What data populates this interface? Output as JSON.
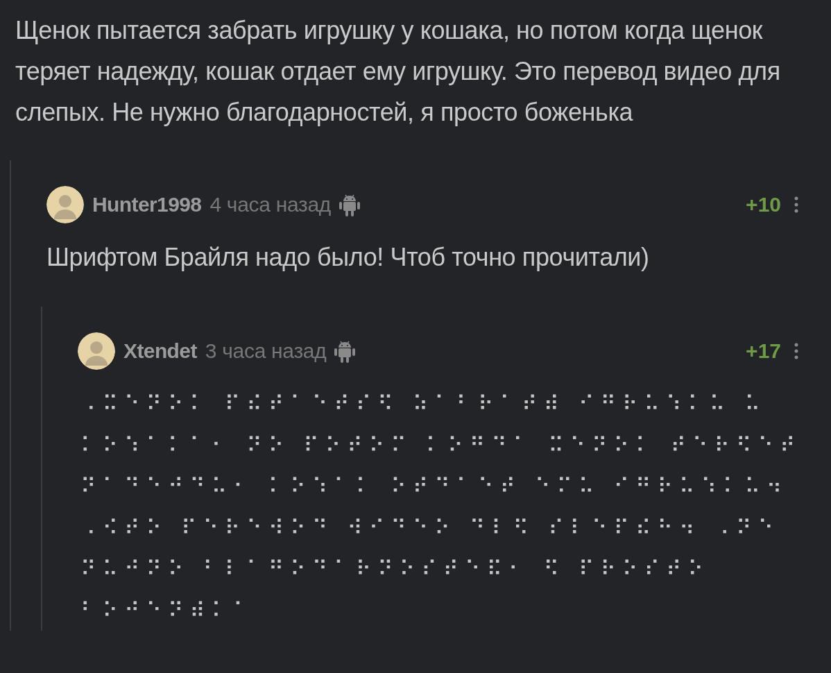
{
  "post": {
    "text": "Щенок пытается забрать игрушку у кошака, но потом когда щенок теряет надежду, кошак отдает ему игрушку. Это перевод видео для слепых. Не нужно благодарностей, я просто боженька"
  },
  "comments": [
    {
      "author": "Hunter1998",
      "time": "4 часа назад",
      "rating": "+10",
      "text": "Шрифтом Брайля надо было! Чтоб точно прочитали)",
      "kind": "plain",
      "children": [
        {
          "author": "Xtendet",
          "time": "3 часа назад",
          "rating": "+17",
          "text": "⠠⠭⠑⠝⠕⠅ ⠏⠮⠞⠁⠑⠞⠎⠫ ⠵⠁⠃⠗⠁⠞⠾ ⠊⠛⠗⠥⠱⠅⠥ ⠥\n⠅⠕⠱⠁⠅⠁⠂ ⠝⠕ ⠏⠕⠞⠕⠍ ⠅⠕⠛⠙⠁ ⠭⠑⠝⠕⠅ ⠞⠑⠗⠫⠑⠞\n⠝⠁⠙⠑⠚⠙⠥⠂ ⠅⠕⠱⠁⠅ ⠕⠞⠙⠁⠑⠞ ⠑⠍⠥ ⠊⠛⠗⠥⠱⠅⠥⠲\n⠠⠪⠞⠕ ⠏⠑⠗⠑⠺⠕⠙ ⠺⠊⠙⠑⠕ ⠙⠇⠫ ⠎⠇⠑⠏⠮⠓⠲ ⠠⠝⠑\n⠝⠥⠚⠝⠕ ⠃⠇⠁⠛⠕⠙⠁⠗⠝⠕⠎⠞⠑⠯⠂ ⠫ ⠏⠗⠕⠎⠞⠕\n⠃⠕⠚⠑⠝⠾⠅⠁",
          "kind": "braille"
        }
      ]
    }
  ]
}
